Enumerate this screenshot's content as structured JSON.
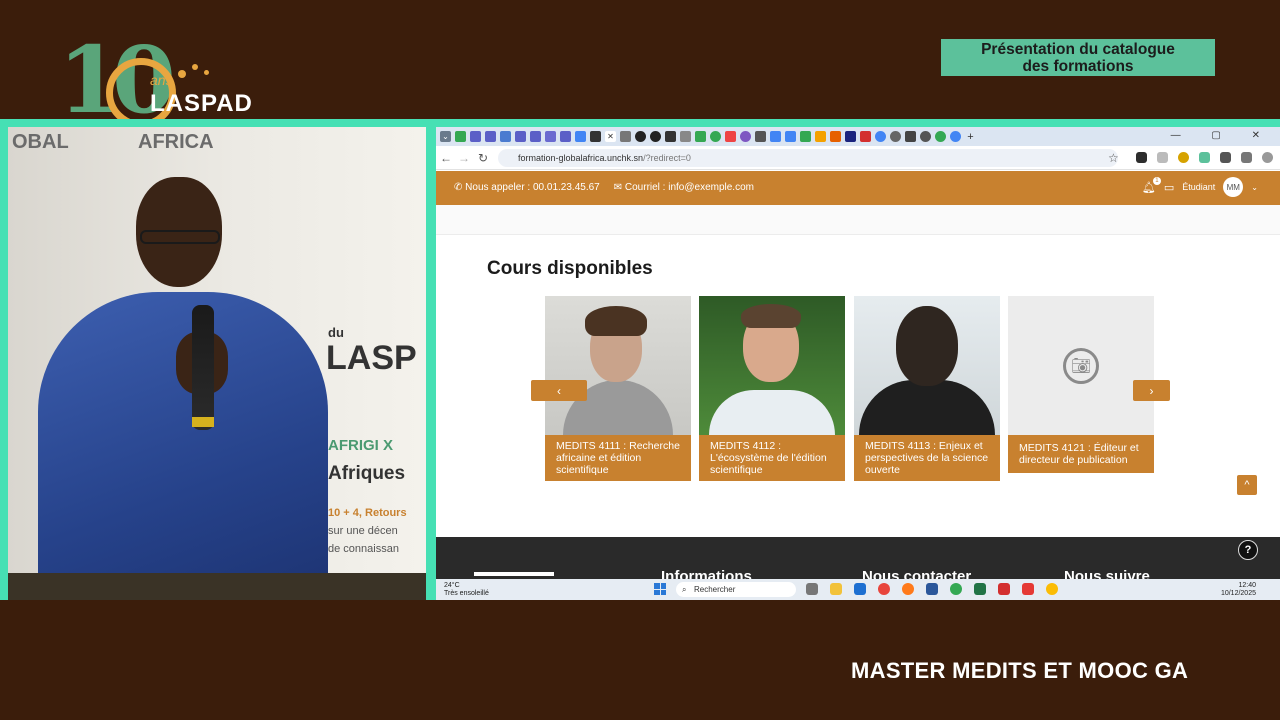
{
  "overlay": {
    "logo_number": "10",
    "logo_ans": "ans",
    "logo_name": "LASPAD",
    "title": "Présentation du catalogue des formations",
    "title_line1": "Présentation du catalogue",
    "title_line2": "des formations",
    "caption": "MASTER MEDITS ET MOOC GA"
  },
  "video": {
    "banner_lines": [
      "OBAL",
      "AFRICA",
      "du",
      "LASP",
      "AFRIGI X",
      "Afriques",
      "10 + 4, Retours",
      "sur une décen",
      "de connaissan"
    ]
  },
  "browser": {
    "url_host": "formation-globalafrica.unchk.sn",
    "url_path": "/?redirect=0",
    "controls": "— ▢ ✕"
  },
  "site": {
    "phone": "Nous appeler : 00.01.23.45.67",
    "email": "Courriel : info@exemple.com",
    "notifications": "1",
    "role": "Étudiant",
    "avatar": "MM",
    "section_title": "Cours disponibles",
    "courses": [
      {
        "label": "MEDITS 4111 : Recherche africaine et édition scientifique"
      },
      {
        "label": "MEDITS 4112 : L'écosystème de l'édition scientifique"
      },
      {
        "label": "MEDITS 4113 : Enjeux et perspectives de la science ouverte"
      },
      {
        "label": "MEDITS 4121 : Éditeur et directeur de publication"
      }
    ],
    "prev": "‹",
    "next": "›",
    "scroll_top": "^",
    "help": "?",
    "footer_cols": [
      "Informations",
      "Nous contacter",
      "Nous suivre"
    ]
  },
  "taskbar": {
    "temp": "24°C",
    "weather": "Très ensoleillé",
    "search": "Rechercher",
    "time": "12:40",
    "date": "10/12/2025"
  },
  "colors": {
    "background": "#3b1d0b",
    "frame": "#46e0b4",
    "accent": "#c8812f",
    "title_box": "#5cc19b"
  }
}
